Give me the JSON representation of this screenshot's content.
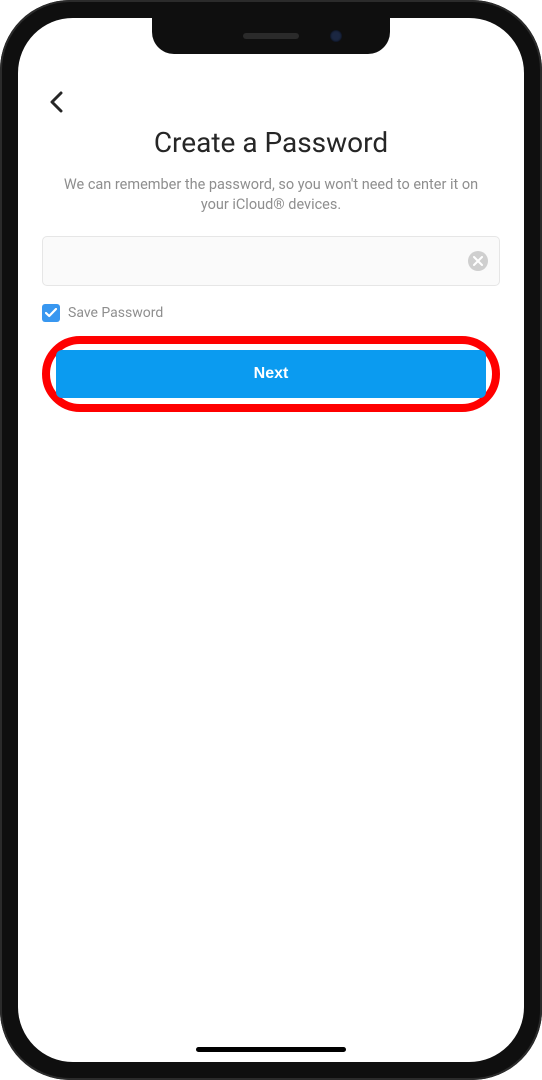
{
  "page": {
    "title": "Create a Password",
    "subtitle": "We can remember the password, so you won't need to enter it on your iCloud® devices."
  },
  "input": {
    "value": "",
    "placeholder": ""
  },
  "savePassword": {
    "checked": true,
    "label": "Save Password"
  },
  "nextButton": {
    "label": "Next"
  },
  "icons": {
    "back": "chevron-left-icon",
    "clear": "clear-icon",
    "check": "check-icon"
  }
}
